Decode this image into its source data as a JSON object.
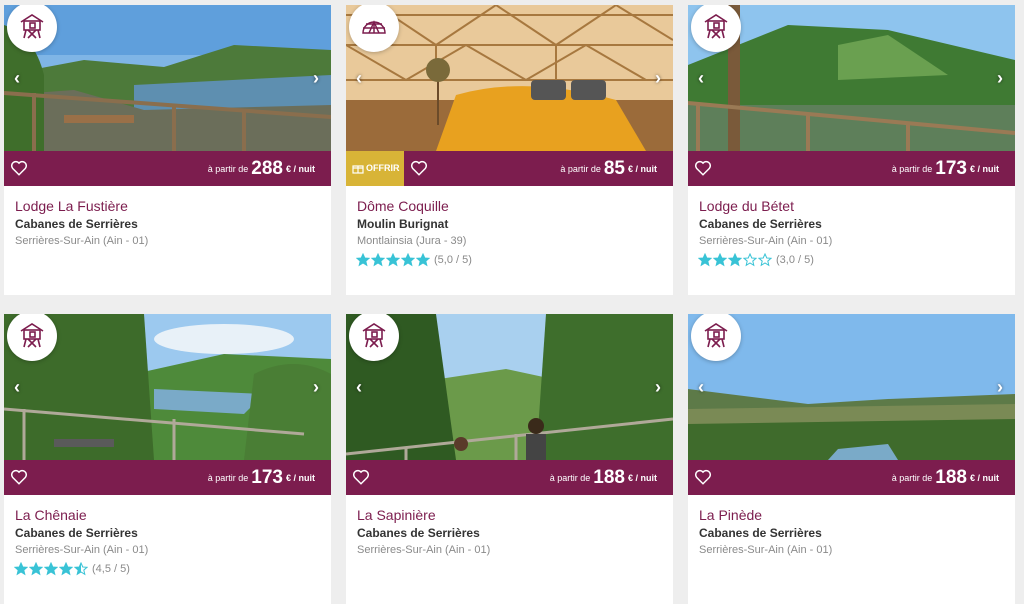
{
  "cards": [
    {
      "title": "Lodge La Fustière",
      "subtitle": "Cabanes de Serrières",
      "location": "Serrières-Sur-Ain (Ain - 01)",
      "price_prefix": "à partir de",
      "price": "288",
      "price_unit": "€ / nuit",
      "badge_icon": "cabin-icon"
    },
    {
      "title": "Dôme Coquille",
      "subtitle": "Moulin Burignat",
      "location": "Montlainsia (Jura - 39)",
      "price_prefix": "à partir de",
      "price": "85",
      "price_unit": "€ / nuit",
      "badge_icon": "dome-icon",
      "offer_label": "OFFRIR",
      "rating_stars": 5,
      "rating_text": "(5,0 / 5)"
    },
    {
      "title": "Lodge du Bétet",
      "subtitle": "Cabanes de Serrières",
      "location": "Serrières-Sur-Ain (Ain - 01)",
      "price_prefix": "à partir de",
      "price": "173",
      "price_unit": "€ / nuit",
      "badge_icon": "cabin-icon",
      "rating_stars": 3,
      "rating_text": "(3,0 / 5)"
    },
    {
      "title": "La Chênaie",
      "subtitle": "Cabanes de Serrières",
      "location": "Serrières-Sur-Ain (Ain - 01)",
      "price_prefix": "à partir de",
      "price": "173",
      "price_unit": "€ / nuit",
      "badge_icon": "cabin-icon",
      "rating_stars": 4.5,
      "rating_text": "(4,5 / 5)"
    },
    {
      "title": "La Sapinière",
      "subtitle": "Cabanes de Serrières",
      "location": "Serrières-Sur-Ain (Ain - 01)",
      "price_prefix": "à partir de",
      "price": "188",
      "price_unit": "€ / nuit",
      "badge_icon": "cabin-icon"
    },
    {
      "title": "La Pinède",
      "subtitle": "Cabanes de Serrières",
      "location": "Serrières-Sur-Ain (Ain - 01)",
      "price_prefix": "à partir de",
      "price": "188",
      "price_unit": "€ / nuit",
      "badge_icon": "cabin-icon"
    }
  ],
  "colors": {
    "brand": "#7c1d4e",
    "offer": "#d8b437",
    "star": "#39c3d6",
    "page_bg": "#eeeeee"
  },
  "nav": {
    "prev_glyph": "‹",
    "next_glyph": "›"
  }
}
